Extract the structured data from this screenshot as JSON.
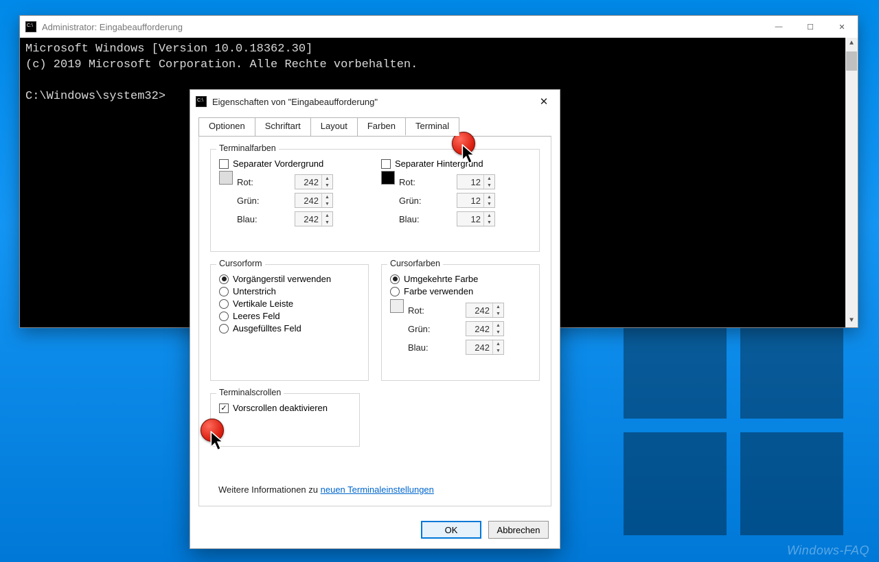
{
  "console": {
    "title": "Administrator: Eingabeaufforderung",
    "line1": "Microsoft Windows [Version 10.0.18362.30]",
    "line2": "(c) 2019 Microsoft Corporation. Alle Rechte vorbehalten.",
    "prompt": "C:\\Windows\\system32>"
  },
  "dialog": {
    "title": "Eigenschaften von \"Eingabeaufforderung\"",
    "tabs": {
      "options": "Optionen",
      "font": "Schriftart",
      "layout": "Layout",
      "colors": "Farben",
      "terminal": "Terminal"
    },
    "terminal_colors": {
      "legend": "Terminalfarben",
      "sep_fg": "Separater Vordergrund",
      "sep_bg": "Separater Hintergrund",
      "red": "Rot:",
      "green": "Grün:",
      "blue": "Blau:",
      "fg": {
        "r": "242",
        "g": "242",
        "b": "242"
      },
      "bg": {
        "r": "12",
        "g": "12",
        "b": "12"
      }
    },
    "cursor_shape": {
      "legend": "Cursorform",
      "legacy": "Vorgängerstil verwenden",
      "underscore": "Unterstrich",
      "vbar": "Vertikale Leiste",
      "emptybox": "Leeres Feld",
      "solidbox": "Ausgefülltes Feld"
    },
    "cursor_colors": {
      "legend": "Cursorfarben",
      "inverse": "Umgekehrte Farbe",
      "use_color": "Farbe verwenden",
      "r": "242",
      "g": "242",
      "b": "242"
    },
    "scroll": {
      "legend": "Terminalscrollen",
      "disable_forward": "Vorscrollen deaktivieren"
    },
    "more_info_prefix": "Weitere Informationen zu ",
    "more_info_link": "neuen Terminaleinstellungen",
    "ok": "OK",
    "cancel": "Abbrechen"
  },
  "watermark": "Windows-FAQ"
}
